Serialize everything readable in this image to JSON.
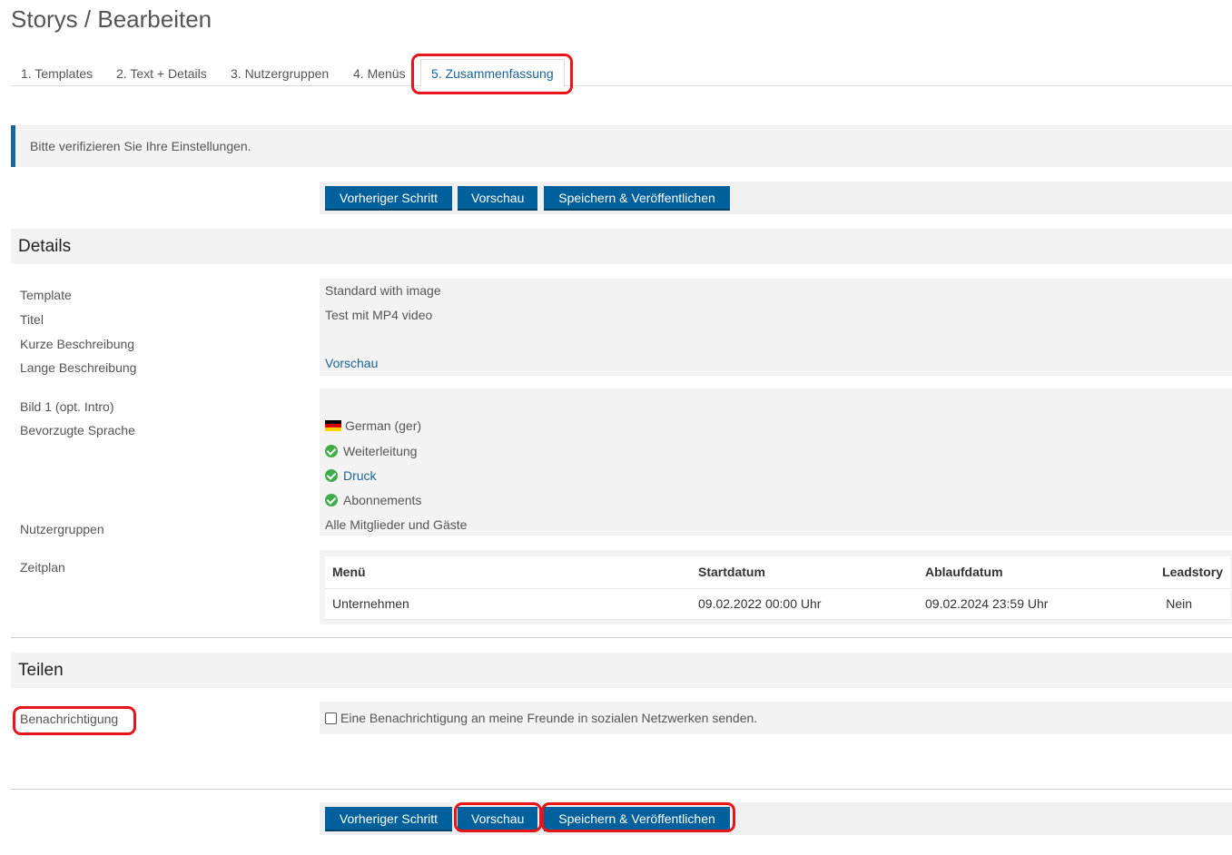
{
  "page": {
    "title": "Storys / Bearbeiten"
  },
  "tabs": [
    {
      "label": "1. Templates"
    },
    {
      "label": "2. Text + Details"
    },
    {
      "label": "3. Nutzergruppen"
    },
    {
      "label": "4. Menüs"
    },
    {
      "label": "5. Zusammenfassung",
      "active": true
    }
  ],
  "alert": {
    "text": "Bitte verifizieren Sie Ihre Einstellungen."
  },
  "buttons": {
    "previous": "Vorheriger Schritt",
    "preview": "Vorschau",
    "save_publish": "Speichern & Veröffentlichen"
  },
  "details": {
    "heading": "Details",
    "labels": {
      "template": "Template",
      "title": "Titel",
      "short_desc": "Kurze Beschreibung",
      "long_desc": "Lange Beschreibung",
      "image": "Bild 1 (opt. Intro)",
      "language": "Bevorzugte Sprache",
      "user_groups": "Nutzergruppen",
      "schedule": "Zeitplan"
    },
    "values": {
      "template": "Standard with image",
      "title": "Test mit MP4 video",
      "long_desc_link": "Vorschau",
      "language": "German (ger)",
      "forwarding": "Weiterleitung",
      "print": "Druck",
      "subscriptions": "Abonnements",
      "user_groups": "Alle Mitglieder und Gäste"
    },
    "icons": {
      "flag": "german-flag-icon",
      "check": "check-circle-icon",
      "check_color": "#3fae49"
    }
  },
  "schedule": {
    "columns": [
      "Menü",
      "Startdatum",
      "Ablaufdatum",
      "Leadstory"
    ],
    "rows": [
      [
        "Unternehmen",
        "09.02.2022 00:00 Uhr",
        "09.02.2024 23:59 Uhr",
        "Nein"
      ]
    ]
  },
  "share": {
    "heading": "Teilen",
    "notification_label": "Benachrichtigung",
    "notification_checkbox": "Eine Benachrichtigung an meine Freunde in sozialen Netzwerken senden."
  },
  "colors": {
    "primary": "#00609c",
    "link": "#1a6496",
    "highlight": "#e8141b"
  }
}
